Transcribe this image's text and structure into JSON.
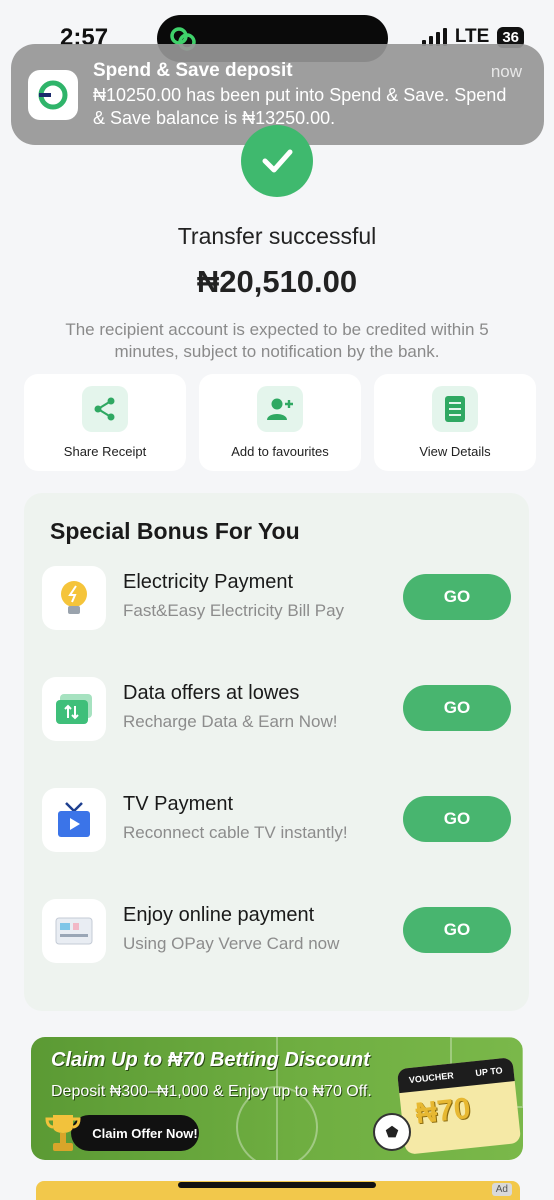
{
  "status_bar": {
    "time": "2:57",
    "network": "LTE",
    "battery": "36"
  },
  "notification": {
    "title": "Spend & Save deposit",
    "time": "now",
    "body": "₦10250.00 has been put into Spend & Save. Spend & Save balance is ₦13250.00."
  },
  "success": {
    "title": "Transfer successful",
    "amount": "₦20,510.00",
    "note": "The recipient account is expected to be credited within 5 minutes, subject to notification by the bank."
  },
  "actions": [
    {
      "label": "Share Receipt",
      "icon": "share-icon"
    },
    {
      "label": "Add to favourites",
      "icon": "add-user-icon"
    },
    {
      "label": "View Details",
      "icon": "document-icon"
    }
  ],
  "bonus": {
    "title": "Special Bonus For You",
    "items": [
      {
        "title": "Electricity Payment",
        "subtitle": "Fast&Easy Electricity Bill Pay",
        "button": "GO",
        "icon": "lightbulb-icon"
      },
      {
        "title": "Data offers at lowes",
        "subtitle": "Recharge Data & Earn Now!",
        "button": "GO",
        "icon": "data-icon"
      },
      {
        "title": "TV Payment",
        "subtitle": "Reconnect cable TV instantly!",
        "button": "GO",
        "icon": "tv-icon"
      },
      {
        "title": "Enjoy online payment",
        "subtitle": "Using OPay Verve Card now",
        "button": "GO",
        "icon": "card-icon"
      }
    ]
  },
  "banner": {
    "title": "Claim Up to ₦70 Betting Discount",
    "subtitle": "Deposit ₦300–₦1,000 & Enjoy up to ₦70 Off.",
    "button": "Claim Offer Now!",
    "voucher_label": "VOUCHER",
    "voucher_upto": "UP TO",
    "voucher_amount": "₦70"
  },
  "ad_badge": "Ad",
  "colors": {
    "accent_green": "#48b56f",
    "success_green": "#3fb96e"
  }
}
